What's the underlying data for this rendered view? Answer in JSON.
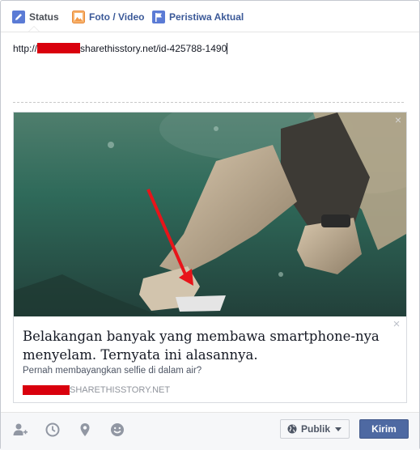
{
  "tabs": [
    {
      "label": "Status",
      "icon": "pencil-icon",
      "active": true
    },
    {
      "label": "Foto / Video",
      "icon": "photo-icon",
      "active": false
    },
    {
      "label": "Peristiwa Aktual",
      "icon": "flag-icon",
      "active": false
    }
  ],
  "composer": {
    "url_prefix": "http://",
    "url_suffix": "sharethisstory.net/id-425788-1490"
  },
  "preview": {
    "title": "Belakangan banyak yang membawa smartphone-nya menyelam. Ternyata ini alasannya.",
    "description": "Pernah membayangkan selfie di dalam air?",
    "source": "SHARETHISSTORY.NET",
    "close_glyph": "×"
  },
  "footer": {
    "icons": [
      "tag-friends-icon",
      "clock-icon",
      "location-pin-icon",
      "smiley-icon"
    ],
    "privacy_label": "Publik",
    "submit_label": "Kirim"
  },
  "colors": {
    "link_blue": "#3b5998",
    "button_blue": "#4e69a2",
    "redaction_red": "#d9000d",
    "annotation_arrow_red": "#e8141a"
  }
}
